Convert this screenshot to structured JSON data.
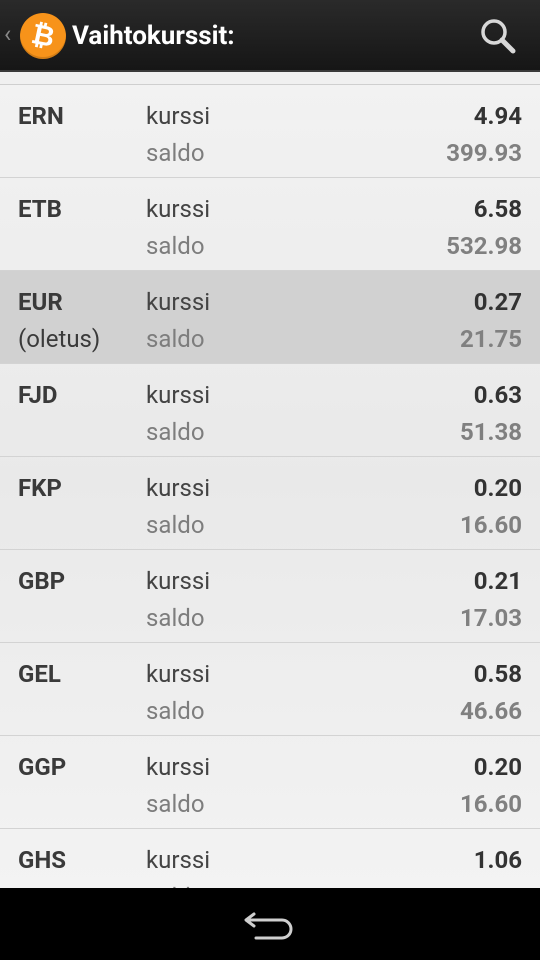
{
  "actionbar": {
    "title": "Vaihtokurssit:",
    "up_glyph": "‹",
    "app_icon": "bitcoin-icon",
    "app_icon_glyph": "₿",
    "search_icon": "search-icon",
    "accent": "#f7931a"
  },
  "labels": {
    "rate": "kurssi",
    "balance": "saldo"
  },
  "currencies": [
    {
      "code": "ERN",
      "note": "",
      "rate": "4.94",
      "balance": "399.93"
    },
    {
      "code": "ETB",
      "note": "",
      "rate": "6.58",
      "balance": "532.98"
    },
    {
      "code": "EUR",
      "note": "(oletus)",
      "rate": "0.27",
      "balance": "21.75"
    },
    {
      "code": "FJD",
      "note": "",
      "rate": "0.63",
      "balance": "51.38"
    },
    {
      "code": "FKP",
      "note": "",
      "rate": "0.20",
      "balance": "16.60"
    },
    {
      "code": "GBP",
      "note": "",
      "rate": "0.21",
      "balance": "17.03"
    },
    {
      "code": "GEL",
      "note": "",
      "rate": "0.58",
      "balance": "46.66"
    },
    {
      "code": "GGP",
      "note": "",
      "rate": "0.20",
      "balance": "16.60"
    },
    {
      "code": "GHS",
      "note": "",
      "rate": "1.06",
      "balance": ""
    }
  ],
  "navbar": {
    "back_icon": "back-arrow-icon"
  }
}
